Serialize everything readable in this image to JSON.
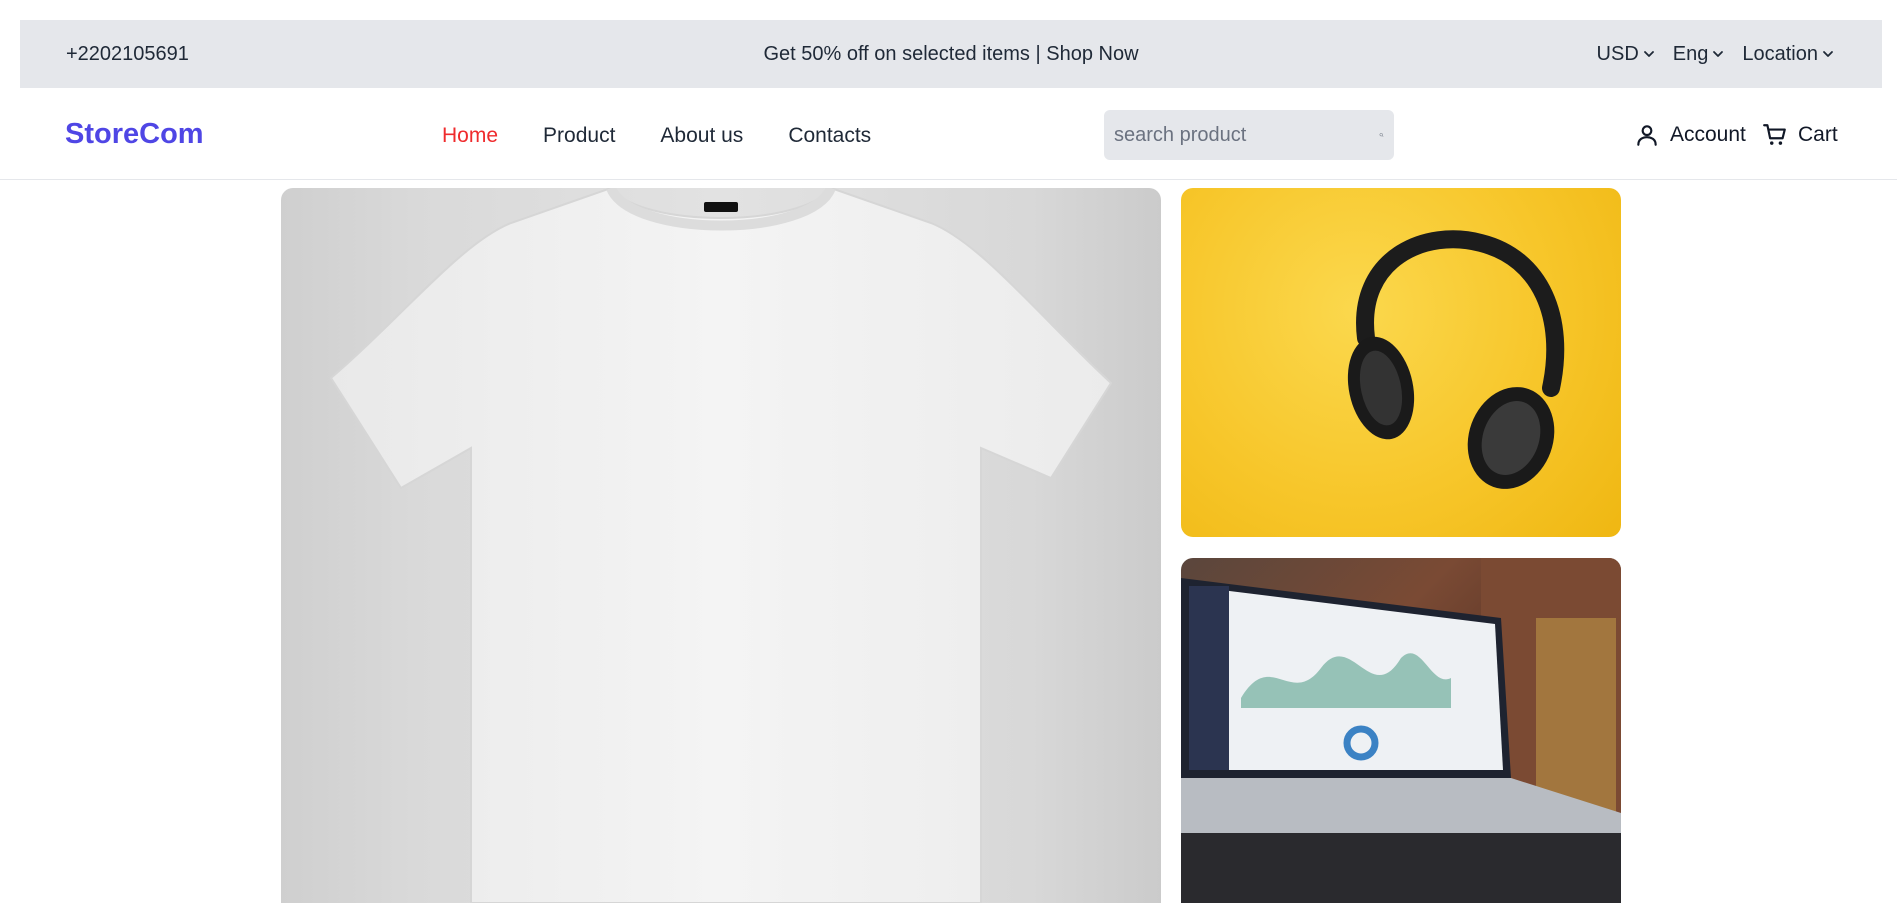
{
  "topbar": {
    "phone": "+2202105691",
    "promo_text": "Get 50% off on selected items | ",
    "promo_link": "Shop Now",
    "currency": "USD",
    "language": "Eng",
    "location": "Location"
  },
  "header": {
    "logo": "StoreCom",
    "nav": [
      {
        "label": "Home"
      },
      {
        "label": "Product"
      },
      {
        "label": "About us"
      },
      {
        "label": "Contacts"
      }
    ],
    "search_placeholder": "search product",
    "account_label": "Account",
    "cart_label": "Cart"
  },
  "colors": {
    "brand": "#4f46e5",
    "active_nav": "#ef2b2d",
    "topbar_bg": "#e5e7eb"
  },
  "hero": {
    "images": [
      {
        "icon": "tshirt-image"
      },
      {
        "icon": "headphones-image"
      },
      {
        "icon": "laptop-dashboard-image"
      }
    ]
  }
}
